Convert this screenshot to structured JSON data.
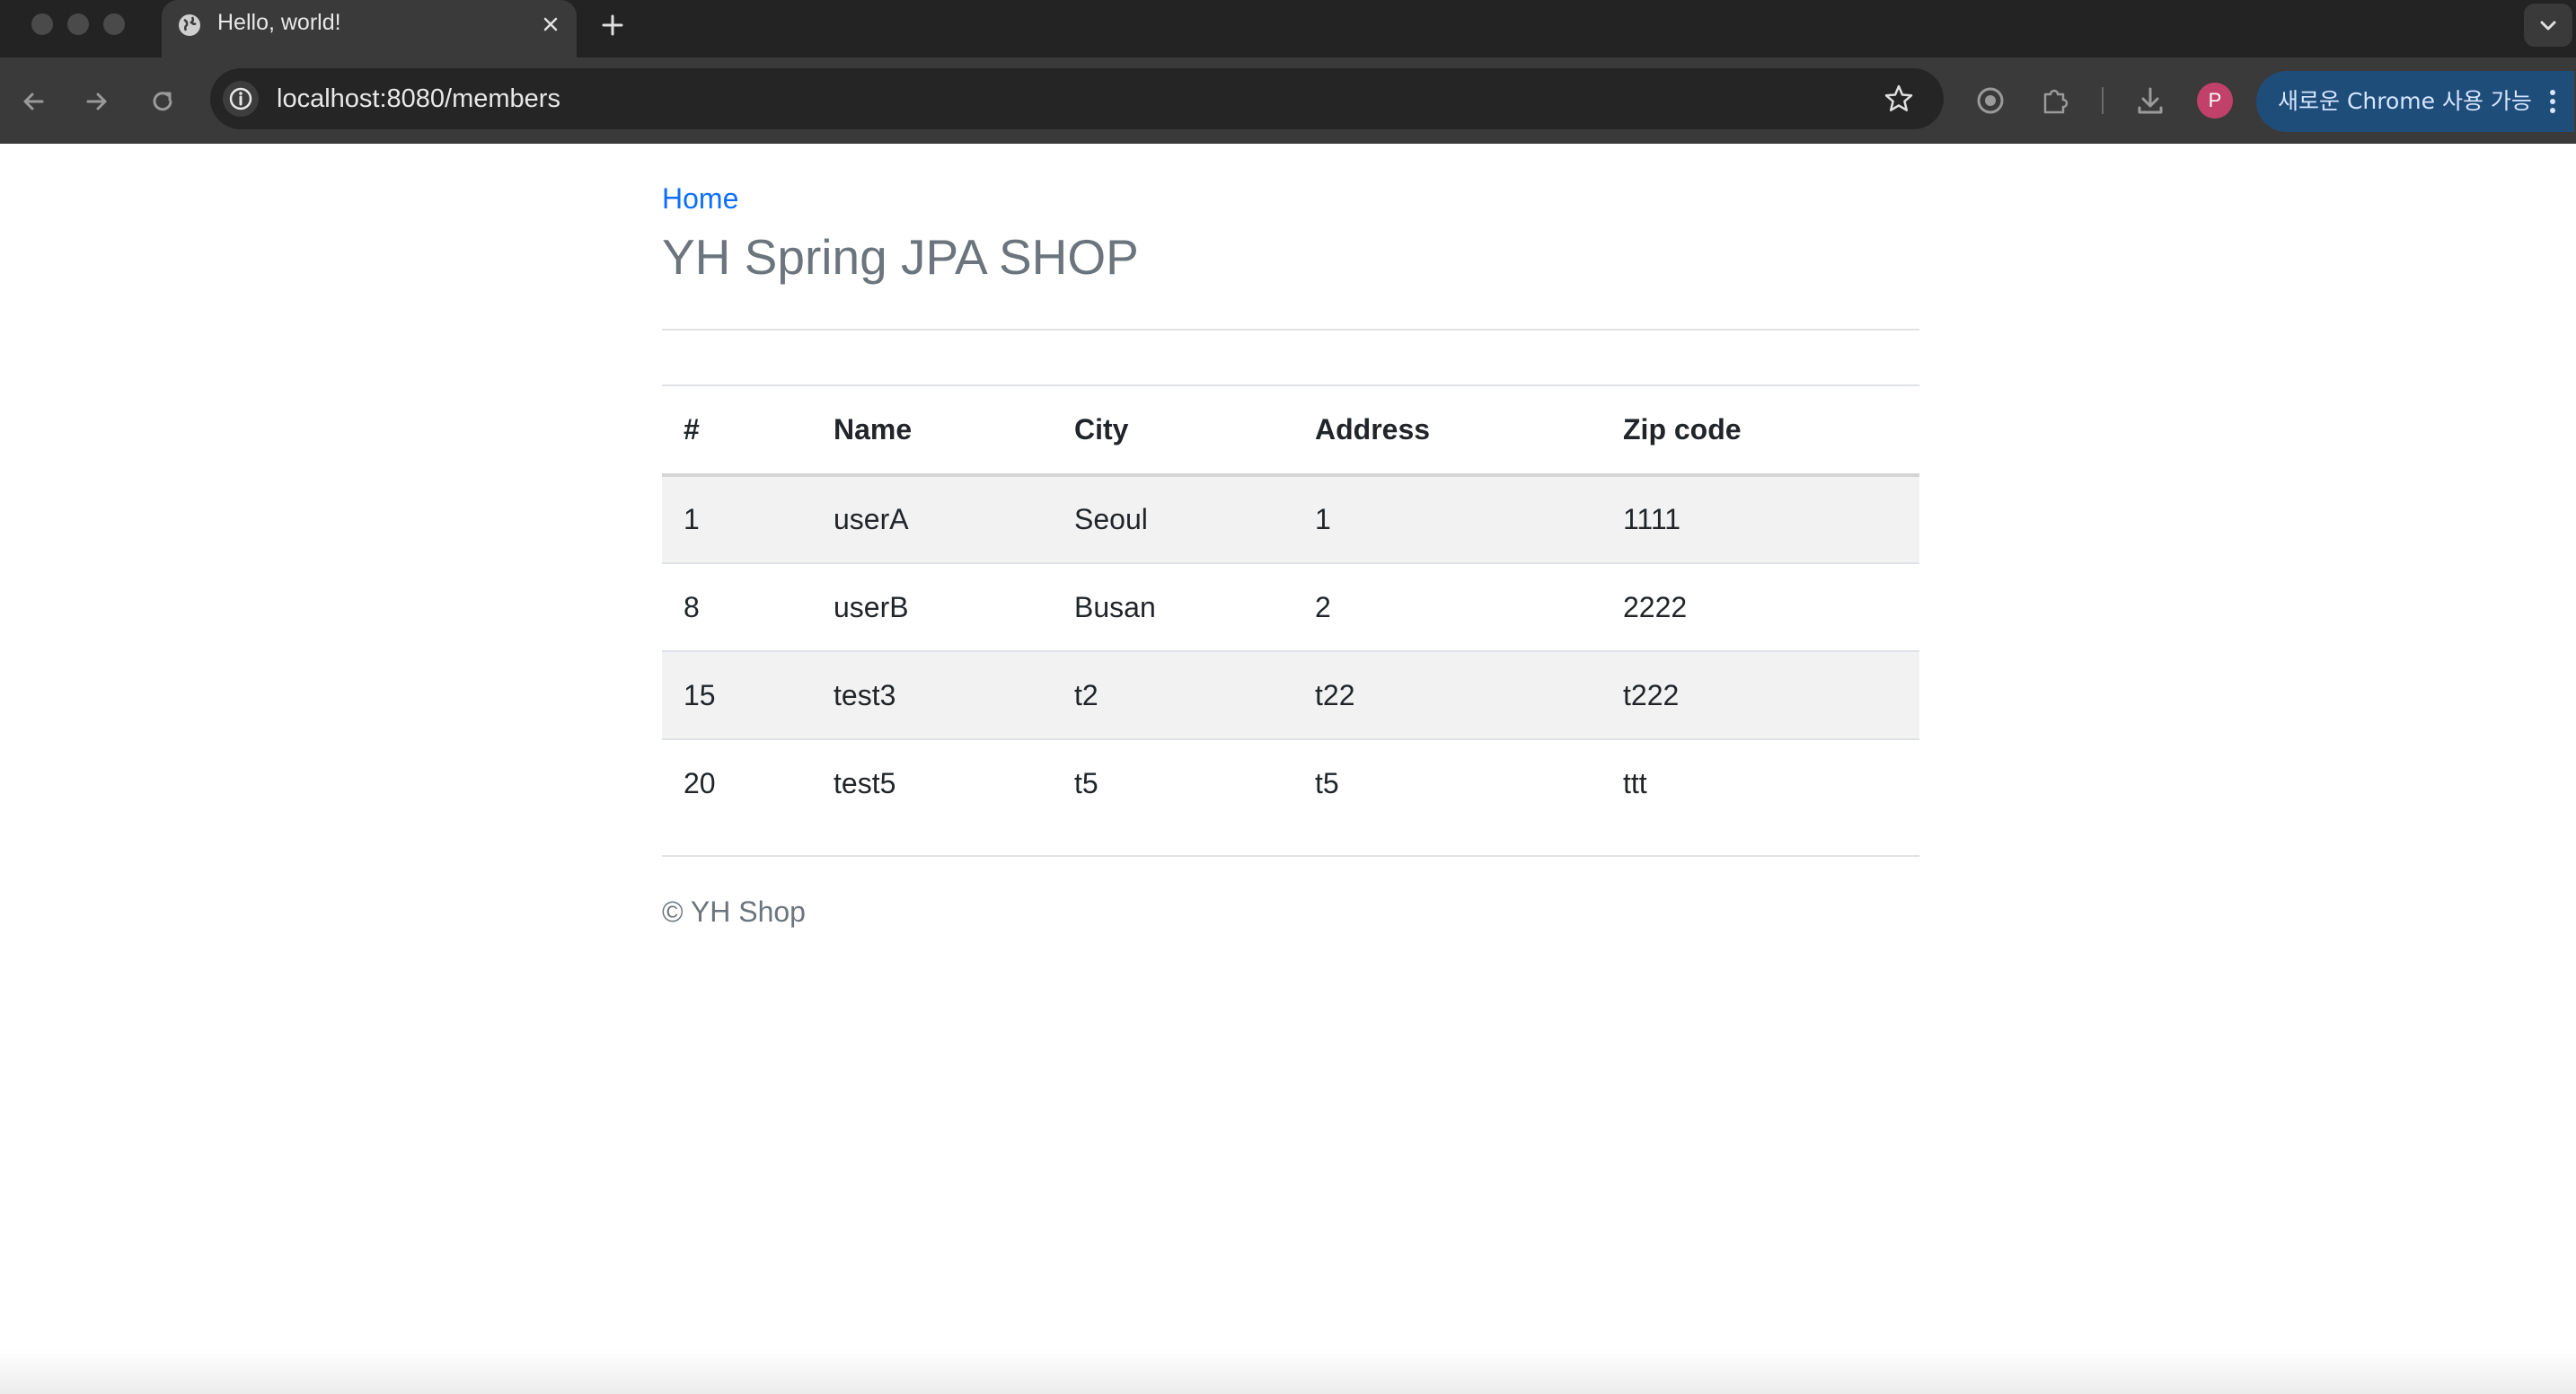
{
  "browser": {
    "tab": {
      "title": "Hello, world!"
    },
    "address_bar": {
      "url": "localhost:8080/members"
    },
    "profile": {
      "initial": "P"
    },
    "update_button": {
      "label": "새로운 Chrome 사용 가능"
    }
  },
  "page": {
    "home_link": "Home",
    "title": "YH Spring JPA SHOP",
    "table": {
      "columns": [
        "#",
        "Name",
        "City",
        "Address",
        "Zip code"
      ],
      "rows": [
        [
          "1",
          "userA",
          "Seoul",
          "1",
          "1111"
        ],
        [
          "8",
          "userB",
          "Busan",
          "2",
          "2222"
        ],
        [
          "15",
          "test3",
          "t2",
          "t22",
          "t222"
        ],
        [
          "20",
          "test5",
          "t5",
          "t5",
          "ttt"
        ]
      ]
    },
    "footer": "© YH Shop"
  },
  "colors": {
    "link": "#0d6efd",
    "title": "#6c757d",
    "striped_row": "#f2f2f2",
    "profile_avatar": "#c2416a",
    "update_button": "#1f4d7a"
  },
  "icons": [
    "globe-icon",
    "close-icon",
    "plus-icon",
    "chevron-down-icon",
    "back-arrow-icon",
    "forward-arrow-icon",
    "reload-icon",
    "info-icon",
    "star-icon",
    "target-icon",
    "puzzle-icon",
    "download-icon",
    "more-vertical-icon"
  ]
}
